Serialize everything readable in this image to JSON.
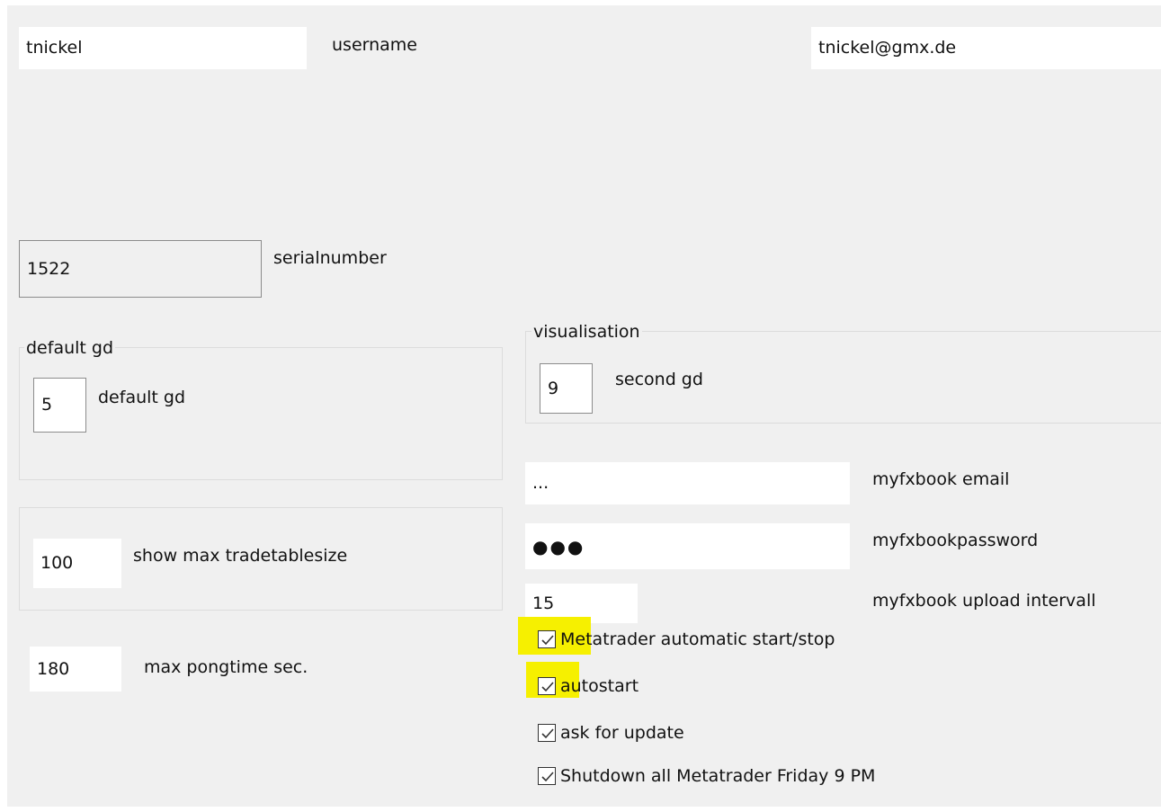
{
  "account": {
    "username_value": "tnickel",
    "username_label": "username",
    "email_value": "tnickel@gmx.de"
  },
  "serial": {
    "value": "1522",
    "label": "serialnumber"
  },
  "default_group": {
    "legend": "default gd",
    "value": "5",
    "label": "default gd"
  },
  "visualisation_group": {
    "legend": "visualisation",
    "value": "9",
    "label": "second gd"
  },
  "tradetable": {
    "value": "100",
    "label": "show max tradetablesize"
  },
  "pong": {
    "value": "180",
    "label": "max pongtime sec."
  },
  "myfxbook": {
    "email_value": "...",
    "email_label": "myfxbook email",
    "password_dots": "●●●",
    "password_label": "myfxbookpassword",
    "interval_value": "15",
    "interval_label": "myfxbook upload intervall"
  },
  "checkboxes": [
    {
      "label": "Metatrader automatic start/stop",
      "checked": true,
      "highlighted": true
    },
    {
      "label": "autostart",
      "checked": true,
      "highlighted": true
    },
    {
      "label": "ask for update",
      "checked": true,
      "highlighted": false
    },
    {
      "label": "Shutdown all Metatrader Friday 9 PM",
      "checked": true,
      "highlighted": false
    }
  ],
  "colors": {
    "panel_bg": "#f0f0f0",
    "highlight": "#f6f000"
  }
}
